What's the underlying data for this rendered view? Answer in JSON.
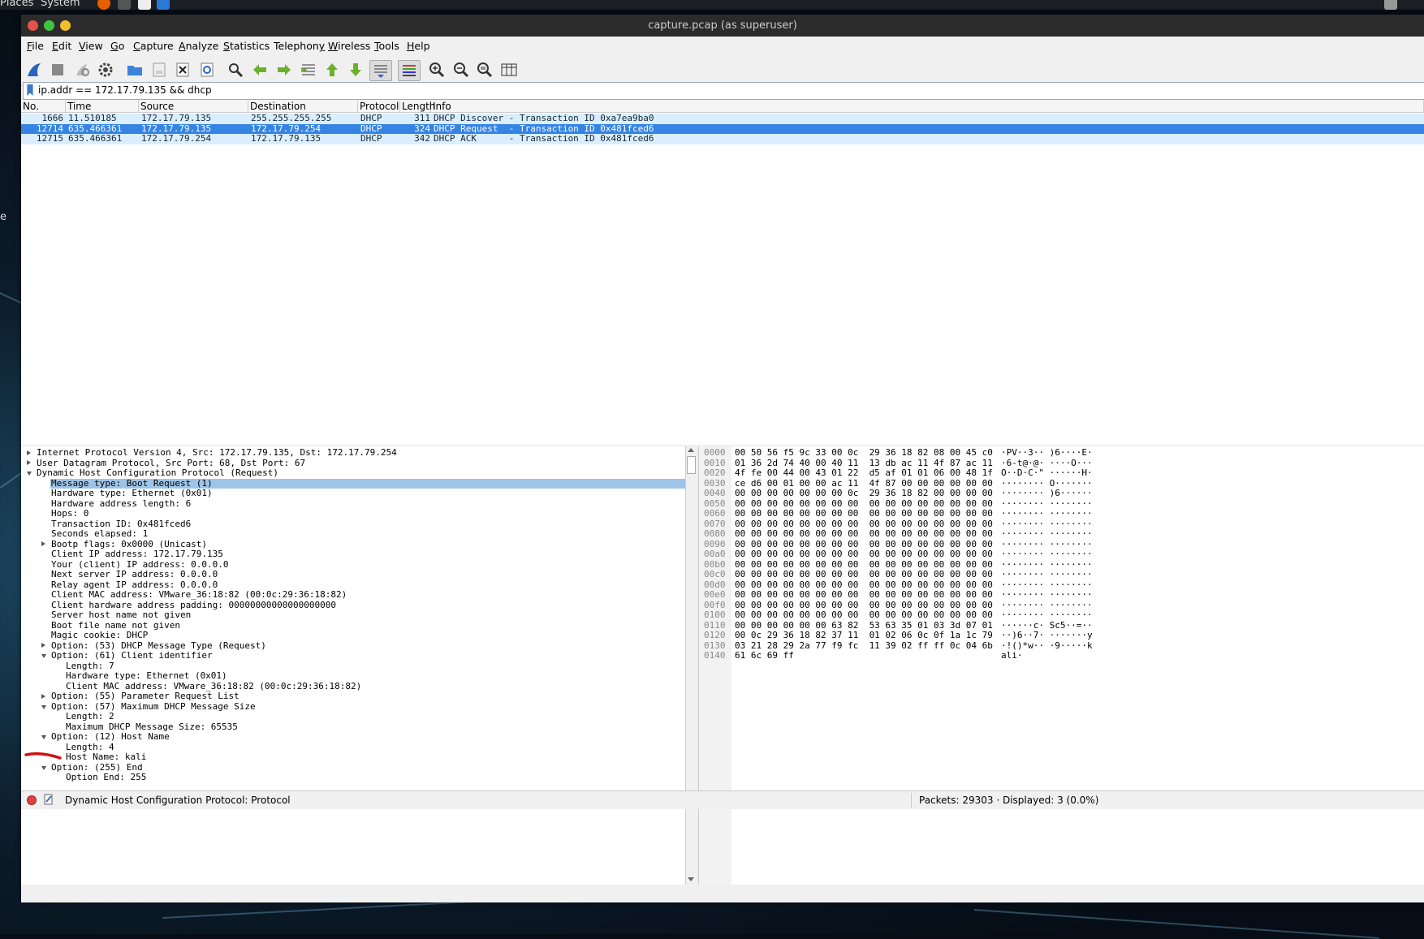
{
  "top_panel": {
    "places": "Places",
    "system": "System"
  },
  "desktop_label": "e",
  "window": {
    "title": "capture.pcap (as superuser)"
  },
  "menu": [
    "File",
    "Edit",
    "View",
    "Go",
    "Capture",
    "Analyze",
    "Statistics",
    "Telephony",
    "Wireless",
    "Tools",
    "Help"
  ],
  "menu_accel": [
    "F",
    "E",
    "V",
    "G",
    "C",
    "A",
    "S",
    "y",
    "W",
    "T",
    "H"
  ],
  "toolbar_icons": [
    "shark-fin-start-icon",
    "stop-icon",
    "restart-icon",
    "capture-options-gear-icon",
    "open-folder-icon",
    "save-file-icon",
    "close-file-icon",
    "reload-icon",
    "find-packet-icon",
    "go-back-icon",
    "go-forward-icon",
    "go-to-packet-icon",
    "first-packet-icon",
    "last-packet-icon",
    "autoscroll-icon",
    "colorize-icon",
    "zoom-in-icon",
    "zoom-out-icon",
    "normal-size-icon",
    "resize-columns-icon"
  ],
  "filter": {
    "value": "ip.addr == 172.17.79.135 && dhcp"
  },
  "packet_list": {
    "columns": [
      "No.",
      "Time",
      "Source",
      "Destination",
      "Protocol",
      "Length",
      "Info"
    ],
    "rows": [
      {
        "no": "1666",
        "time": "11.510185",
        "src": "172.17.79.135",
        "dst": "255.255.255.255",
        "proto": "DHCP",
        "len": "311",
        "info": "DHCP Discover - Transaction ID 0xa7ea9ba0"
      },
      {
        "no": "12714",
        "time": "635.466361",
        "src": "172.17.79.135",
        "dst": "172.17.79.254",
        "proto": "DHCP",
        "len": "324",
        "info": "DHCP Request  - Transaction ID 0x481fced6"
      },
      {
        "no": "12715",
        "time": "635.466361",
        "src": "172.17.79.254",
        "dst": "172.17.79.135",
        "proto": "DHCP",
        "len": "342",
        "info": "DHCP ACK      - Transaction ID 0x481fced6"
      }
    ],
    "selected_index": 1
  },
  "details": [
    {
      "text": "Internet Protocol Version 4, Src: 172.17.79.135, Dst: 172.17.79.254",
      "level": 0,
      "exp": "r"
    },
    {
      "text": "User Datagram Protocol, Src Port: 68, Dst Port: 67",
      "level": 0,
      "exp": "r"
    },
    {
      "text": "Dynamic Host Configuration Protocol (Request)",
      "level": 0,
      "exp": "d"
    },
    {
      "text": "Message type: Boot Request (1)",
      "level": 1,
      "exp": "",
      "sel": true
    },
    {
      "text": "Hardware type: Ethernet (0x01)",
      "level": 1,
      "exp": ""
    },
    {
      "text": "Hardware address length: 6",
      "level": 1,
      "exp": ""
    },
    {
      "text": "Hops: 0",
      "level": 1,
      "exp": ""
    },
    {
      "text": "Transaction ID: 0x481fced6",
      "level": 1,
      "exp": ""
    },
    {
      "text": "Seconds elapsed: 1",
      "level": 1,
      "exp": ""
    },
    {
      "text": "Bootp flags: 0x0000 (Unicast)",
      "level": 1,
      "exp": "r"
    },
    {
      "text": "Client IP address: 172.17.79.135",
      "level": 1,
      "exp": ""
    },
    {
      "text": "Your (client) IP address: 0.0.0.0",
      "level": 1,
      "exp": ""
    },
    {
      "text": "Next server IP address: 0.0.0.0",
      "level": 1,
      "exp": ""
    },
    {
      "text": "Relay agent IP address: 0.0.0.0",
      "level": 1,
      "exp": ""
    },
    {
      "text": "Client MAC address: VMware_36:18:82 (00:0c:29:36:18:82)",
      "level": 1,
      "exp": ""
    },
    {
      "text": "Client hardware address padding: 00000000000000000000",
      "level": 1,
      "exp": ""
    },
    {
      "text": "Server host name not given",
      "level": 1,
      "exp": ""
    },
    {
      "text": "Boot file name not given",
      "level": 1,
      "exp": ""
    },
    {
      "text": "Magic cookie: DHCP",
      "level": 1,
      "exp": ""
    },
    {
      "text": "Option: (53) DHCP Message Type (Request)",
      "level": 1,
      "exp": "r"
    },
    {
      "text": "Option: (61) Client identifier",
      "level": 1,
      "exp": "d"
    },
    {
      "text": "Length: 7",
      "level": 2,
      "exp": ""
    },
    {
      "text": "Hardware type: Ethernet (0x01)",
      "level": 2,
      "exp": ""
    },
    {
      "text": "Client MAC address: VMware_36:18:82 (00:0c:29:36:18:82)",
      "level": 2,
      "exp": ""
    },
    {
      "text": "Option: (55) Parameter Request List",
      "level": 1,
      "exp": "r"
    },
    {
      "text": "Option: (57) Maximum DHCP Message Size",
      "level": 1,
      "exp": "d"
    },
    {
      "text": "Length: 2",
      "level": 2,
      "exp": ""
    },
    {
      "text": "Maximum DHCP Message Size: 65535",
      "level": 2,
      "exp": ""
    },
    {
      "text": "Option: (12) Host Name",
      "level": 1,
      "exp": "d"
    },
    {
      "text": "Length: 4",
      "level": 2,
      "exp": ""
    },
    {
      "text": "Host Name: kali",
      "level": 2,
      "exp": ""
    },
    {
      "text": "Option: (255) End",
      "level": 1,
      "exp": "d"
    },
    {
      "text": "Option End: 255",
      "level": 2,
      "exp": ""
    }
  ],
  "hex": [
    {
      "off": "0000",
      "bytes": "00 50 56 f5 9c 33 00 0c  29 36 18 82 08 00 45 c0",
      "ascii": "·PV··3·· )6····E·"
    },
    {
      "off": "0010",
      "bytes": "01 36 2d 74 40 00 40 11  13 db ac 11 4f 87 ac 11",
      "ascii": "·6-t@·@· ····O···"
    },
    {
      "off": "0020",
      "bytes": "4f fe 00 44 00 43 01 22  d5 af 01 01 06 00 48 1f",
      "ascii": "O··D·C·\" ······H·"
    },
    {
      "off": "0030",
      "bytes": "ce d6 00 01 00 00 ac 11  4f 87 00 00 00 00 00 00",
      "ascii": "········ O·······"
    },
    {
      "off": "0040",
      "bytes": "00 00 00 00 00 00 00 0c  29 36 18 82 00 00 00 00",
      "ascii": "········ )6······"
    },
    {
      "off": "0050",
      "bytes": "00 00 00 00 00 00 00 00  00 00 00 00 00 00 00 00",
      "ascii": "········ ········"
    },
    {
      "off": "0060",
      "bytes": "00 00 00 00 00 00 00 00  00 00 00 00 00 00 00 00",
      "ascii": "········ ········"
    },
    {
      "off": "0070",
      "bytes": "00 00 00 00 00 00 00 00  00 00 00 00 00 00 00 00",
      "ascii": "········ ········"
    },
    {
      "off": "0080",
      "bytes": "00 00 00 00 00 00 00 00  00 00 00 00 00 00 00 00",
      "ascii": "········ ········"
    },
    {
      "off": "0090",
      "bytes": "00 00 00 00 00 00 00 00  00 00 00 00 00 00 00 00",
      "ascii": "········ ········"
    },
    {
      "off": "00a0",
      "bytes": "00 00 00 00 00 00 00 00  00 00 00 00 00 00 00 00",
      "ascii": "········ ········"
    },
    {
      "off": "00b0",
      "bytes": "00 00 00 00 00 00 00 00  00 00 00 00 00 00 00 00",
      "ascii": "········ ········"
    },
    {
      "off": "00c0",
      "bytes": "00 00 00 00 00 00 00 00  00 00 00 00 00 00 00 00",
      "ascii": "········ ········"
    },
    {
      "off": "00d0",
      "bytes": "00 00 00 00 00 00 00 00  00 00 00 00 00 00 00 00",
      "ascii": "········ ········"
    },
    {
      "off": "00e0",
      "bytes": "00 00 00 00 00 00 00 00  00 00 00 00 00 00 00 00",
      "ascii": "········ ········"
    },
    {
      "off": "00f0",
      "bytes": "00 00 00 00 00 00 00 00  00 00 00 00 00 00 00 00",
      "ascii": "········ ········"
    },
    {
      "off": "0100",
      "bytes": "00 00 00 00 00 00 00 00  00 00 00 00 00 00 00 00",
      "ascii": "········ ········"
    },
    {
      "off": "0110",
      "bytes": "00 00 00 00 00 00 63 82  53 63 35 01 03 3d 07 01",
      "ascii": "······c· Sc5··=··"
    },
    {
      "off": "0120",
      "bytes": "00 0c 29 36 18 82 37 11  01 02 06 0c 0f 1a 1c 79",
      "ascii": "··)6··7· ·······y"
    },
    {
      "off": "0130",
      "bytes": "03 21 28 29 2a 77 f9 fc  11 39 02 ff ff 0c 04 6b",
      "ascii": "·!()*w·· ·9·····k"
    },
    {
      "off": "0140",
      "bytes": "61 6c 69 ff",
      "ascii": "ali·"
    }
  ],
  "status": {
    "text": "Dynamic Host Configuration Protocol: Protocol",
    "count": "Packets: 29303 · Displayed: 3 (0.0%)"
  },
  "colors": {
    "selected_row": "#3584e4",
    "row_bg": "#daeeff",
    "selected_detail": "#9ec4e8",
    "annotation": "#d01010"
  }
}
